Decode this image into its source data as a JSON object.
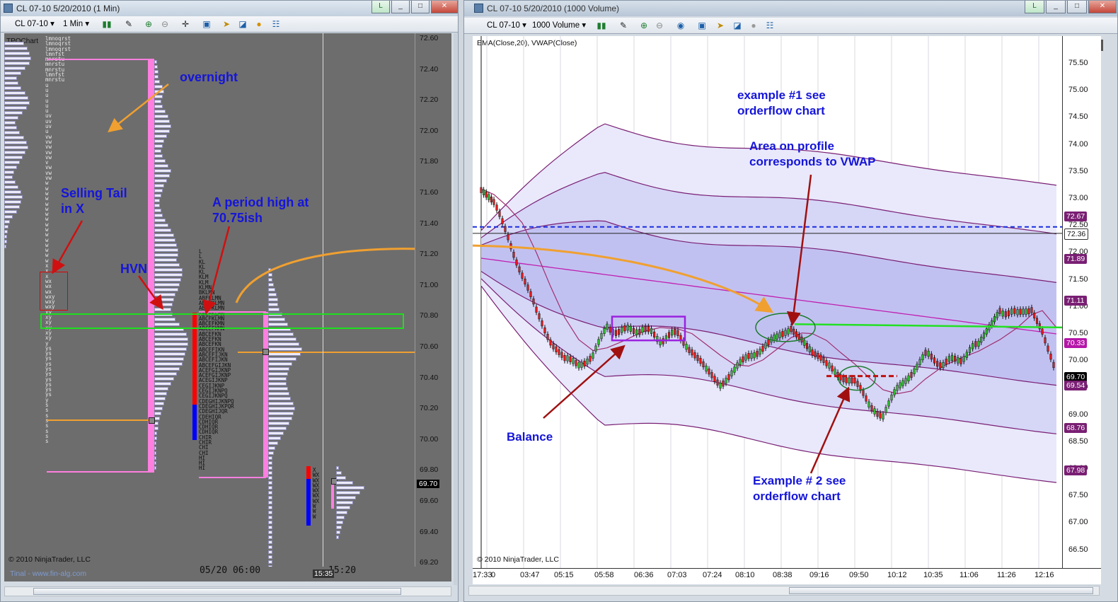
{
  "left_window": {
    "title": "CL 07-10  5/20/2010 (1 Min)",
    "instrument": "CL 07-10",
    "interval": "1 Min",
    "chart_label": "TPOChart",
    "copyright": "© 2010 NinjaTrader, LLC",
    "footer_link": "Tinal - www.fin-alg.com",
    "session_date": "05/20 06:00",
    "cursor_time": "15:35",
    "partial_time": "15:20",
    "last_price": "69.70",
    "y_ticks": [
      "72.60",
      "72.40",
      "72.20",
      "72.00",
      "71.80",
      "71.60",
      "71.40",
      "71.20",
      "71.00",
      "70.80",
      "70.60",
      "70.40",
      "70.20",
      "70.00",
      "69.80",
      "69.60",
      "69.40",
      "69.20"
    ],
    "tpo_col1": [
      "lmnoqrst",
      "lmnoqrst",
      "lmnoqrst",
      "lmnfst",
      "mnrstu",
      "mnrstu",
      "mnrstu",
      "lmnfst",
      "mnrstu",
      "u",
      "u",
      "u",
      "u",
      "u",
      "u",
      "uv",
      "uv",
      "uv",
      "u",
      "vw",
      "vw",
      "vw",
      "vw",
      "vw",
      "v",
      "vw",
      "vw",
      "vw",
      "w",
      "w",
      "w",
      "w",
      "w",
      "w",
      "w",
      "w",
      "w",
      "w",
      "w",
      "w",
      "w",
      "w",
      "w",
      "w",
      "x",
      "x",
      "x",
      "wx",
      "wx",
      "wx",
      "wxy",
      "wxy",
      "wxy",
      "xy",
      "xy",
      "xy",
      "xy",
      "xy",
      "xy",
      "y",
      "ys",
      "ys",
      "ys",
      "ys",
      "ys",
      "ys",
      "ys",
      "ys",
      "ys",
      "ys",
      "y",
      "s",
      "s",
      "s",
      "s",
      "s",
      "s",
      "s",
      "s"
    ],
    "tpo_col2": [
      "L",
      "L",
      "KL",
      "KL",
      "KL",
      "KLM",
      "KLM",
      "KLMN",
      "BKLMN",
      "ABFKLMN",
      "ABEFKLMN",
      "ABCFKLMN",
      "ABCFKLMN",
      "ABCFKLMN",
      "ABCEFKMN",
      "ABCEFKMN",
      "ABCEFKN",
      "ABCEFKN",
      "ABCEFKN",
      "ABCEFIKN",
      "ABCEFIJKN",
      "ABCEFIJKN",
      "ABCEFGIJKN",
      "ACEFGIJKNP",
      "ACEFGIJKNP",
      "ACEGIJKNP",
      "CEGIJKNP",
      "CEGIJKNPQ",
      "CEGIJKNPQ",
      "CDEGHIJKNPQ",
      "CDEGHIJKPQR",
      "CDEGHIJQR",
      "CDEHIQR",
      "CDHIQR",
      "CDHIQR",
      "CDHIQR",
      "CHIR",
      "CHIR",
      "CHI",
      "CHI",
      "HI",
      "HI",
      "HI"
    ],
    "tpo_col3": [
      "X",
      "WX",
      "WX",
      "WX",
      "WX",
      "WX",
      "WX",
      "W",
      "W",
      "W"
    ],
    "notes": {
      "overnight": "overnight",
      "selling_tail": "Selling Tail\nin X",
      "hvn": "HVN",
      "period_high": "A period high at\n70.75ish"
    }
  },
  "right_window": {
    "title": "CL 07-10  5/20/2010 (1000 Volume)",
    "instrument": "CL 07-10",
    "interval": "1000 Volume",
    "indicators": "EMA(Close,20), VWAP(Close)",
    "copyright": "© 2010 NinjaTrader, LLC",
    "y_ticks": [
      "75.50",
      "75.00",
      "74.50",
      "74.00",
      "73.50",
      "73.00",
      "72.50",
      "72.00",
      "71.50",
      "71.00",
      "70.50",
      "70.00",
      "69.50",
      "69.00",
      "68.50",
      "68.00",
      "67.50",
      "67.00",
      "66.50"
    ],
    "badges": [
      {
        "value": "72.67",
        "color": "#7a1f74"
      },
      {
        "value": "72.36",
        "color": "#ffffff"
      },
      {
        "value": "71.89",
        "color": "#7a1f74"
      },
      {
        "value": "71.11",
        "color": "#7a1f74"
      },
      {
        "value": "70.33",
        "color": "#b516a8"
      },
      {
        "value": "69.70",
        "color": "#000000"
      },
      {
        "value": "69.54",
        "color": "#7a1f74"
      },
      {
        "value": "68.76",
        "color": "#7a1f74"
      },
      {
        "value": "67.98",
        "color": "#7a1f74"
      }
    ],
    "x_ticks": [
      "17:33",
      "0",
      "03:47",
      "05:15",
      "05:58",
      "06:36",
      "07:03",
      "07:24",
      "08:10",
      "08:38",
      "09:16",
      "09:50",
      "10:12",
      "10:35",
      "11:06",
      "11:26",
      "12:16"
    ],
    "notes": {
      "example1": "example #1 see\norderflow chart",
      "area": "Area on profile\ncorresponds to VWAP",
      "balance": "Balance",
      "example2": "Example # 2 see\norderflow chart"
    }
  }
}
